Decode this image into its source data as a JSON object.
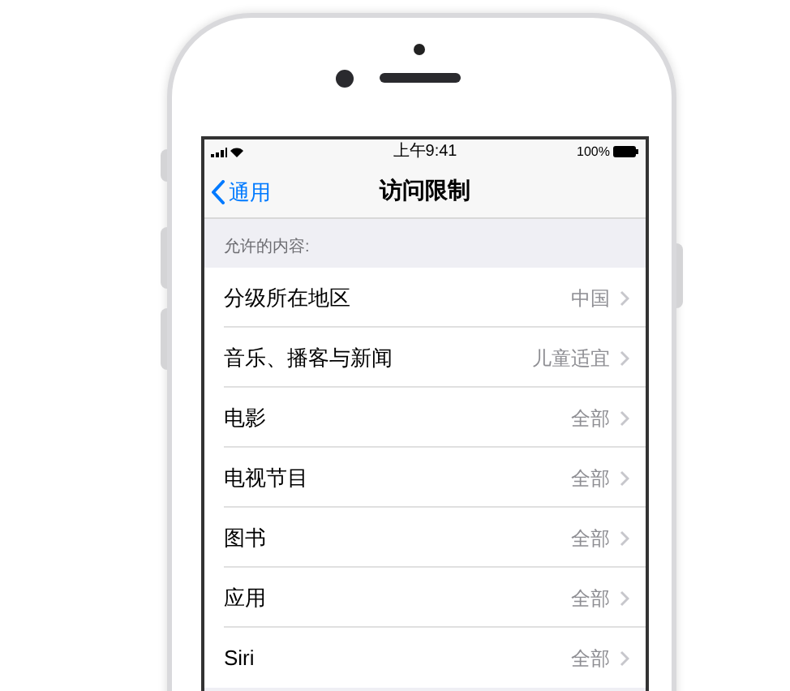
{
  "status_bar": {
    "time": "上午9:41",
    "battery": "100%"
  },
  "nav_bar": {
    "back": "通用",
    "title": "访问限制"
  },
  "section_header": "允许的内容:",
  "rows": [
    {
      "label": "分级所在地区",
      "value": "中国"
    },
    {
      "label": "音乐、播客与新闻",
      "value": "儿童适宜"
    },
    {
      "label": "电影",
      "value": "全部"
    },
    {
      "label": "电视节目",
      "value": "全部"
    },
    {
      "label": "图书",
      "value": "全部"
    },
    {
      "label": "应用",
      "value": "全部"
    },
    {
      "label": "Siri",
      "value": "全部"
    }
  ]
}
